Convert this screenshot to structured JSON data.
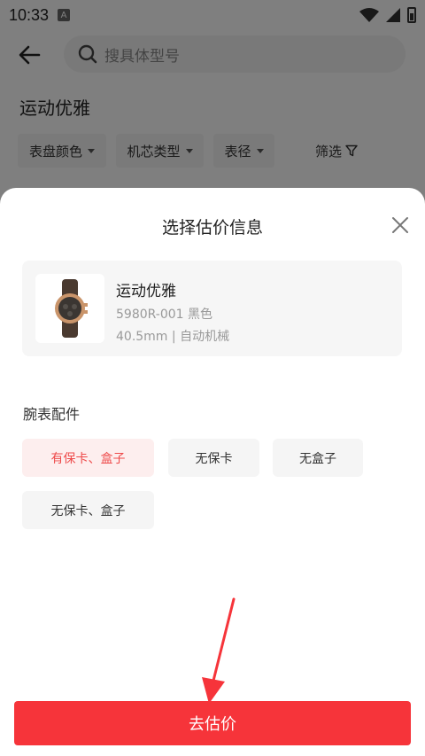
{
  "status_bar": {
    "time": "10:33",
    "notice_icon_letter": "A",
    "icons": [
      "wifi-icon",
      "signal-icon",
      "battery-icon"
    ]
  },
  "search": {
    "placeholder": "搜具体型号"
  },
  "background": {
    "title": "运动优雅",
    "filters": [
      "表盘颜色",
      "机芯类型",
      "表径"
    ],
    "filter_screen_label": "筛选"
  },
  "sheet": {
    "title": "选择估价信息",
    "product": {
      "name": "运动优雅",
      "model_color": "5980R-001 黑色",
      "spec": "40.5mm | 自动机械"
    },
    "accessories_label": "腕表配件",
    "options": [
      {
        "label": "有保卡、盒子",
        "selected": true
      },
      {
        "label": "无保卡",
        "selected": false
      },
      {
        "label": "无盒子",
        "selected": false
      },
      {
        "label": "无保卡、盒子",
        "selected": false
      }
    ],
    "submit_label": "去估价"
  },
  "colors": {
    "accent_red": "#f6343a",
    "selected_text": "#ee4b4b",
    "selected_bg": "#fdeeee"
  }
}
